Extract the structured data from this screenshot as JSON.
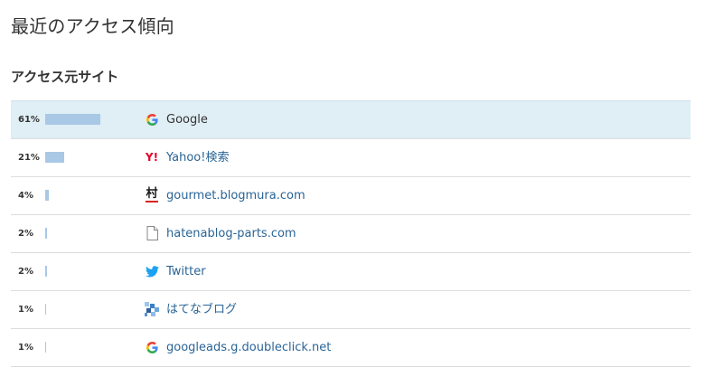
{
  "page": {
    "title": "最近のアクセス傾向"
  },
  "section": {
    "title": "アクセス元サイト"
  },
  "colors": {
    "bar": "#a8c8e6",
    "highlight_row": "#e0eef5",
    "link": "#2a6496"
  },
  "referrers": [
    {
      "percent_label": "61%",
      "percent": 61,
      "site": "Google",
      "icon": "google-icon",
      "highlighted": true
    },
    {
      "percent_label": "21%",
      "percent": 21,
      "site": "Yahoo!検索",
      "icon": "yahoo-icon",
      "highlighted": false
    },
    {
      "percent_label": "4%",
      "percent": 4,
      "site": "gourmet.blogmura.com",
      "icon": "blogmura-icon",
      "highlighted": false
    },
    {
      "percent_label": "2%",
      "percent": 2,
      "site": "hatenablog-parts.com",
      "icon": "document-icon",
      "highlighted": false
    },
    {
      "percent_label": "2%",
      "percent": 2,
      "site": "Twitter",
      "icon": "twitter-icon",
      "highlighted": false
    },
    {
      "percent_label": "1%",
      "percent": 1,
      "site": "はてなブログ",
      "icon": "hatena-icon",
      "highlighted": false
    },
    {
      "percent_label": "1%",
      "percent": 1,
      "site": "googleads.g.doubleclick.net",
      "icon": "google-icon",
      "highlighted": false
    }
  ]
}
